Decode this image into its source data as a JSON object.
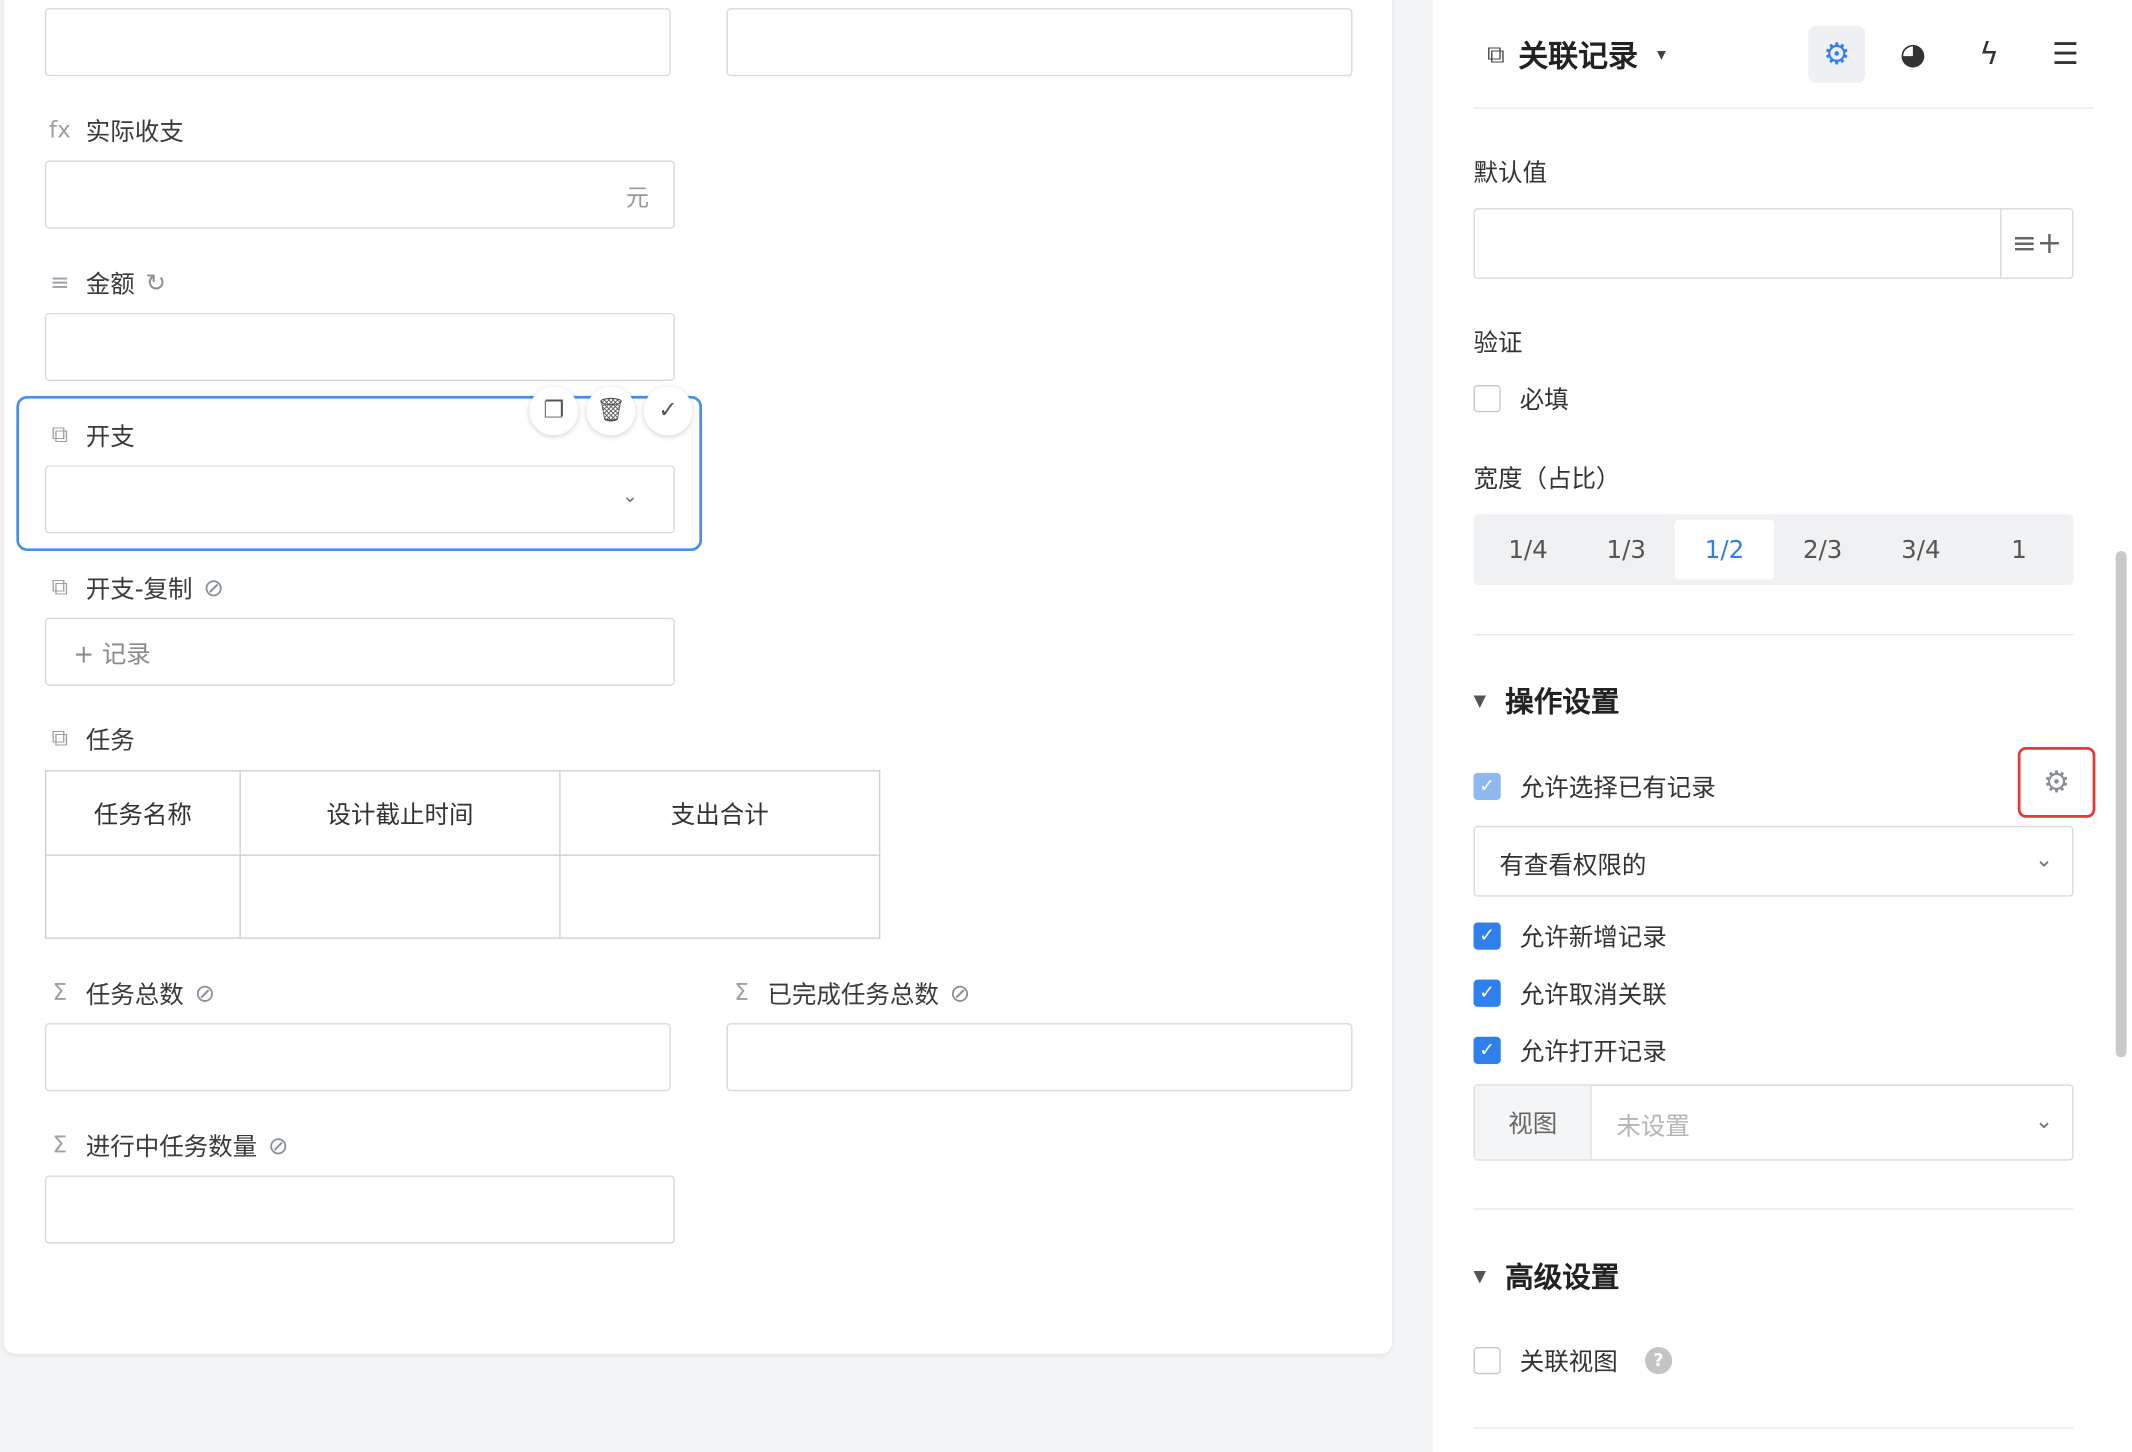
{
  "form": {
    "actual_balance": {
      "icon": "fx",
      "label": "实际收支",
      "suffix": "元"
    },
    "amount": {
      "icon": "≡",
      "label": "金额",
      "refresh_icon": "↻"
    },
    "expense": {
      "icon": "⧉",
      "label": "开支",
      "chevron": "⌄"
    },
    "expense_copy": {
      "icon": "⧉",
      "label": "开支-复制",
      "hidden_icon": "⊘",
      "add_record": "+ 记录"
    },
    "tasks": {
      "icon": "⧉",
      "label": "任务",
      "columns": [
        "任务名称",
        "设计截止时间",
        "支出合计"
      ]
    },
    "task_total": {
      "icon": "Σ",
      "label": "任务总数",
      "hidden_icon": "⊘"
    },
    "task_done_total": {
      "icon": "Σ",
      "label": "已完成任务总数",
      "hidden_icon": "⊘"
    },
    "task_in_progress": {
      "icon": "Σ",
      "label": "进行中任务数量",
      "hidden_icon": "⊘"
    },
    "tools": {
      "copy": "❐",
      "delete": "🗑",
      "confirm": "✓"
    }
  },
  "panel": {
    "header": {
      "icon": "⧉",
      "title": "关联记录",
      "caret": "▾",
      "tabs": [
        {
          "name": "settings",
          "glyph": "⚙"
        },
        {
          "name": "style",
          "glyph": "◕"
        },
        {
          "name": "action",
          "glyph": "ϟ"
        },
        {
          "name": "sort",
          "glyph": "☰"
        }
      ]
    },
    "default_value": {
      "label": "默认值",
      "btn": "≡+"
    },
    "validation": {
      "label": "验证",
      "required": "必填"
    },
    "width": {
      "label": "宽度（占比）",
      "options": [
        "1/4",
        "1/3",
        "1/2",
        "2/3",
        "3/4",
        "1"
      ],
      "selected": "1/2"
    },
    "operations": {
      "title": "操作设置",
      "allow_select": "允许选择已有记录",
      "gear": "⚙",
      "scope": "有查看权限的",
      "allow_create": "允许新增记录",
      "allow_unlink": "允许取消关联",
      "allow_open": "允许打开记录",
      "view_prefix": "视图",
      "view_placeholder": "未设置"
    },
    "advanced": {
      "title": "高级设置",
      "linked_view": "关联视图",
      "help": "?"
    }
  },
  "colors": {
    "accent": "#2f80ed",
    "highlight": "#e53935",
    "selected_border": "#4a90e2"
  }
}
